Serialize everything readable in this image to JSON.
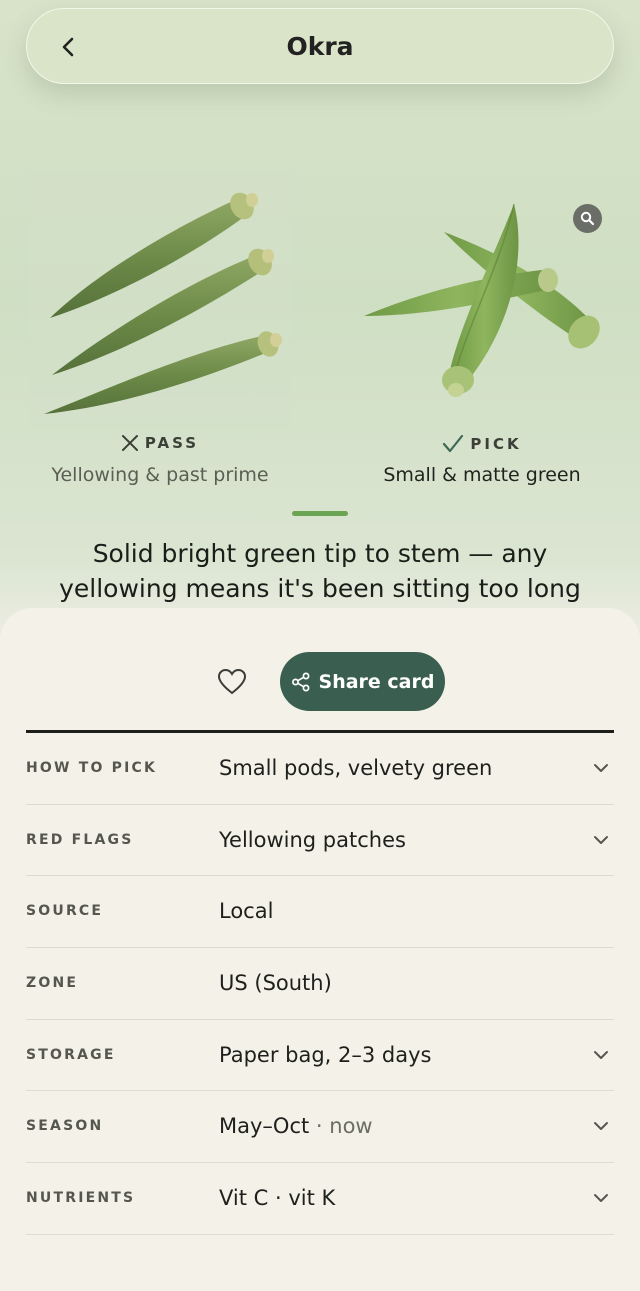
{
  "header": {
    "back_icon": "chevron-left-icon",
    "title": "Okra"
  },
  "compare": {
    "pass": {
      "icon": "x-icon",
      "label": "PASS",
      "caption": "Yellowing & past prime"
    },
    "pick": {
      "icon": "check-icon",
      "label": "PICK",
      "caption": "Small & matte green"
    },
    "zoom_icon": "magnifier-icon"
  },
  "headline": "Solid bright green tip to stem — any yellowing means it's been sitting too long",
  "actions": {
    "favorite_icon": "heart-icon",
    "share_icon": "share-icon",
    "share_label": "Share card"
  },
  "details": [
    {
      "key": "HOW TO PICK",
      "value": "Small pods, velvety green",
      "expandable": true
    },
    {
      "key": "RED FLAGS",
      "value": "Yellowing patches",
      "expandable": true
    },
    {
      "key": "SOURCE",
      "value": "Local",
      "expandable": false
    },
    {
      "key": "ZONE",
      "value": "US (South)",
      "expandable": false
    },
    {
      "key": "STORAGE",
      "value": "Paper bag, 2–3 days",
      "expandable": true
    },
    {
      "key": "SEASON",
      "value": "May–Oct",
      "suffix": " · now",
      "expandable": true
    },
    {
      "key": "NUTRIENTS",
      "value": "Vit C · vit K",
      "expandable": true
    }
  ],
  "colors": {
    "accent": "#3a5f50",
    "indicator": "#69a552",
    "background_top": "#d8e3c9",
    "sheet": "#f4f1e8"
  }
}
